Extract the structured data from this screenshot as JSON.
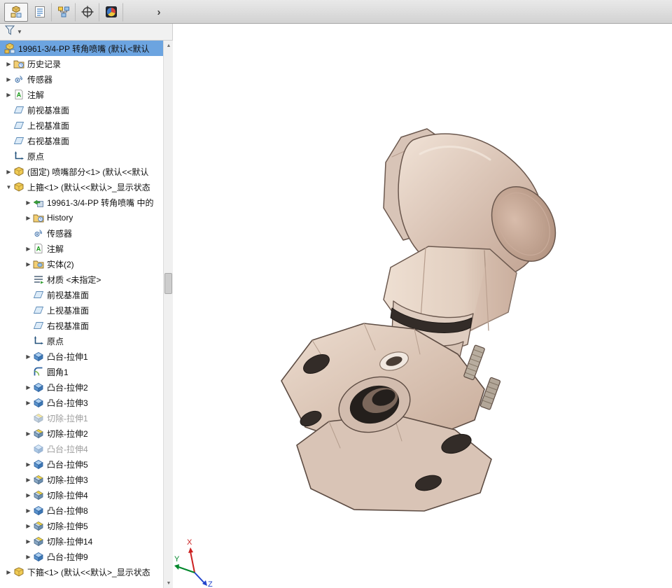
{
  "colors": {
    "selection": "#6ca4e0",
    "toolbar_bg": "#d8d8d8",
    "model_body": "#decbbd",
    "model_outline": "#5d4c43",
    "axis_x": "#cc2222",
    "axis_y": "#00872b",
    "axis_z": "#2244cc"
  },
  "toolbar": {
    "tabs": [
      {
        "name": "featuremanager-design-tree",
        "active": true
      },
      {
        "name": "propertymanager",
        "active": false
      },
      {
        "name": "configurationmanager",
        "active": false
      },
      {
        "name": "dimxpertmanager",
        "active": false
      },
      {
        "name": "displaymanager",
        "active": false
      }
    ],
    "flyout_chevron": "›"
  },
  "filter": {
    "icon": "filter-funnel",
    "caret": "▼"
  },
  "tree": {
    "rows": [
      {
        "label": "19961-3/4-PP 转角喷嘴 (默认<默认",
        "level": 0,
        "icon": "assembly",
        "arrow": "none",
        "state": "selected"
      },
      {
        "label": "历史记录",
        "level": 1,
        "icon": "history",
        "arrow": "collapsed",
        "state": "normal"
      },
      {
        "label": "传感器",
        "level": 1,
        "icon": "sensors",
        "arrow": "collapsed",
        "state": "normal"
      },
      {
        "label": "注解",
        "level": 1,
        "icon": "annotations",
        "arrow": "collapsed",
        "state": "normal"
      },
      {
        "label": "前视基准面",
        "level": 1,
        "icon": "plane",
        "arrow": "none",
        "state": "normal"
      },
      {
        "label": "上视基准面",
        "level": 1,
        "icon": "plane",
        "arrow": "none",
        "state": "normal"
      },
      {
        "label": "右视基准面",
        "level": 1,
        "icon": "plane",
        "arrow": "none",
        "state": "normal"
      },
      {
        "label": "原点",
        "level": 1,
        "icon": "origin",
        "arrow": "none",
        "state": "normal"
      },
      {
        "label": "(固定) 喷嘴部分<1> (默认<<默认",
        "level": 1,
        "icon": "part",
        "arrow": "collapsed",
        "state": "normal"
      },
      {
        "label": "上箍<1> (默认<<默认>_显示状态",
        "level": 1,
        "icon": "part",
        "arrow": "expanded",
        "state": "normal"
      },
      {
        "label": "19961-3/4-PP 转角喷嘴 中的",
        "level": 2,
        "icon": "derived",
        "arrow": "collapsed",
        "state": "normal"
      },
      {
        "label": "History",
        "level": 2,
        "icon": "history",
        "arrow": "collapsed",
        "state": "normal"
      },
      {
        "label": "传感器",
        "level": 2,
        "icon": "sensors",
        "arrow": "none",
        "state": "normal"
      },
      {
        "label": "注解",
        "level": 2,
        "icon": "annotations",
        "arrow": "collapsed",
        "state": "normal"
      },
      {
        "label": "实体(2)",
        "level": 2,
        "icon": "solids",
        "arrow": "collapsed",
        "state": "normal"
      },
      {
        "label": "材质 <未指定>",
        "level": 2,
        "icon": "material",
        "arrow": "none",
        "state": "normal"
      },
      {
        "label": "前视基准面",
        "level": 2,
        "icon": "plane",
        "arrow": "none",
        "state": "normal"
      },
      {
        "label": "上视基准面",
        "level": 2,
        "icon": "plane",
        "arrow": "none",
        "state": "normal"
      },
      {
        "label": "右视基准面",
        "level": 2,
        "icon": "plane",
        "arrow": "none",
        "state": "normal"
      },
      {
        "label": "原点",
        "level": 2,
        "icon": "origin",
        "arrow": "none",
        "state": "normal"
      },
      {
        "label": "凸台-拉伸1",
        "level": 2,
        "icon": "boss",
        "arrow": "collapsed",
        "state": "normal"
      },
      {
        "label": "圆角1",
        "level": 2,
        "icon": "fillet",
        "arrow": "none",
        "state": "normal"
      },
      {
        "label": "凸台-拉伸2",
        "level": 2,
        "icon": "boss",
        "arrow": "collapsed",
        "state": "normal"
      },
      {
        "label": "凸台-拉伸3",
        "level": 2,
        "icon": "boss",
        "arrow": "collapsed",
        "state": "normal"
      },
      {
        "label": "切除-拉伸1",
        "level": 2,
        "icon": "cut",
        "arrow": "none",
        "state": "suppressed"
      },
      {
        "label": "切除-拉伸2",
        "level": 2,
        "icon": "cut",
        "arrow": "collapsed",
        "state": "normal"
      },
      {
        "label": "凸台-拉伸4",
        "level": 2,
        "icon": "boss",
        "arrow": "none",
        "state": "suppressed"
      },
      {
        "label": "凸台-拉伸5",
        "level": 2,
        "icon": "boss",
        "arrow": "collapsed",
        "state": "normal"
      },
      {
        "label": "切除-拉伸3",
        "level": 2,
        "icon": "cut",
        "arrow": "collapsed",
        "state": "normal"
      },
      {
        "label": "切除-拉伸4",
        "level": 2,
        "icon": "cut",
        "arrow": "collapsed",
        "state": "normal"
      },
      {
        "label": "凸台-拉伸8",
        "level": 2,
        "icon": "boss",
        "arrow": "collapsed",
        "state": "normal"
      },
      {
        "label": "切除-拉伸5",
        "level": 2,
        "icon": "cut",
        "arrow": "collapsed",
        "state": "normal"
      },
      {
        "label": "切除-拉伸14",
        "level": 2,
        "icon": "cut",
        "arrow": "collapsed",
        "state": "normal"
      },
      {
        "label": "凸台-拉伸9",
        "level": 2,
        "icon": "boss",
        "arrow": "collapsed",
        "state": "normal"
      },
      {
        "label": "下箍<1> (默认<<默认>_显示状态",
        "level": 1,
        "icon": "part",
        "arrow": "collapsed",
        "state": "normal"
      }
    ]
  },
  "viewport": {
    "model_name": "corner-nozzle-with-pipe-clamp",
    "triad": {
      "x_label": "X",
      "y_label": "Y",
      "z_label": "Z"
    }
  }
}
